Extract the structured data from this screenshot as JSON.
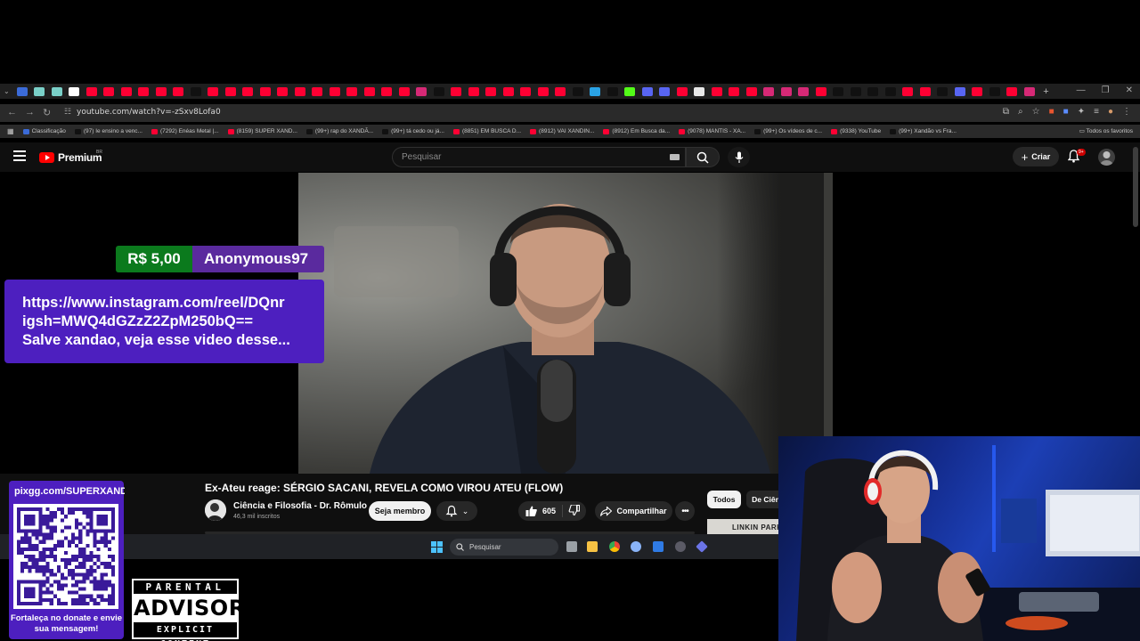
{
  "browser": {
    "url": "youtube.com/watch?v=-zSxv8Lofa0",
    "tab_colors": [
      "#3b6bd8",
      "#7ad0c8",
      "#7ad0c8",
      "#ffffff",
      "#ff0033",
      "#ff0033",
      "#ff0033",
      "#ff0033",
      "#ff0033",
      "#ff0033",
      "#111111",
      "#ff0033",
      "#ff0033",
      "#ff0033",
      "#ff0033",
      "#ff0033",
      "#ff0033",
      "#ff0033",
      "#ff0033",
      "#ff0033",
      "#ff0033",
      "#ff0033",
      "#ff0033",
      "#d62976",
      "#111111",
      "#ff0033",
      "#ff0033",
      "#ff0033",
      "#ff0033",
      "#ff0033",
      "#ff0033",
      "#ff0033",
      "#111111",
      "#2aa3e6",
      "#111111",
      "#53fc18",
      "#5865f2",
      "#5865f2",
      "#ff0033",
      "#e8e8e8",
      "#ff0033",
      "#ff0033",
      "#ff0033",
      "#d62976",
      "#d62976",
      "#d62976",
      "#ff0033",
      "#111111",
      "#111111",
      "#111111",
      "#111111",
      "#ff0033",
      "#ff0033",
      "#111111",
      "#5865f2",
      "#ff0033",
      "#111111",
      "#ff0033",
      "#d62976"
    ],
    "bookmarks": [
      {
        "label": "Classificação",
        "color": "#3b6bd8"
      },
      {
        "label": "(97) Ie ensino a venc...",
        "color": "#111111"
      },
      {
        "label": "(7292) Enéas Metal |...",
        "color": "#ff0033"
      },
      {
        "label": "(8159) SUPER XAND...",
        "color": "#ff0033"
      },
      {
        "label": "(99+) rap do XANDÃ...",
        "color": "#111111"
      },
      {
        "label": "(99+) tá cedo ou já...",
        "color": "#111111"
      },
      {
        "label": "(8851) EM BUSCA D...",
        "color": "#ff0033"
      },
      {
        "label": "(8912) VAI XANDIN...",
        "color": "#ff0033"
      },
      {
        "label": "(8912) Em Busca da...",
        "color": "#ff0033"
      },
      {
        "label": "(9078) MANTIS - XA...",
        "color": "#ff0033"
      },
      {
        "label": "(99+) Os vídeos de c...",
        "color": "#111111"
      },
      {
        "label": "(9338) YouTube",
        "color": "#ff0033"
      },
      {
        "label": "(99+) Xandão vs Fra...",
        "color": "#111111"
      }
    ],
    "all_bookmarks": "Todos os favoritos"
  },
  "youtube": {
    "logo_text": "Premium",
    "logo_region": "BR",
    "search_placeholder": "Pesquisar",
    "create_label": "Criar",
    "notif_badge": "9+",
    "video_title": "Ex-Ateu reage: SÉRGIO SACANI, REVELA COMO VIROU ATEU (FLOW)",
    "channel_name": "Ciência e Filosofia - Dr. Rômulo",
    "subscribers": "46,3 mil inscritos",
    "member_label": "Seja membro",
    "likes": "605",
    "share_label": "Compartilhar",
    "chip_all": "Todos",
    "chip_de": "De Ciên",
    "thumb_text": "LINKIN PARK"
  },
  "donation": {
    "amount": "R$ 5,00",
    "donor": "Anonymous97",
    "message_lines": [
      "https://www.instagram.com/reel/DQnr",
      "igsh=MWQ4dGZzZ2ZpM250bQ==",
      "Salve xandao, veja esse video desse..."
    ]
  },
  "overlay": {
    "pix_url": "pixgg.com/SUPERXANDAO",
    "pix_caption": "Fortaleça no donate e envie sua mensagem!",
    "advisory_top": "PARENTAL",
    "advisory_mid": "ADVISORY",
    "advisory_bot": "EXPLICIT CONTENT"
  },
  "taskbar": {
    "search_label": "Pesquisar"
  },
  "colors": {
    "yt_red": "#ff0000",
    "donation_purple": "#4d1fbf",
    "donation_green": "#0b7a1d"
  }
}
